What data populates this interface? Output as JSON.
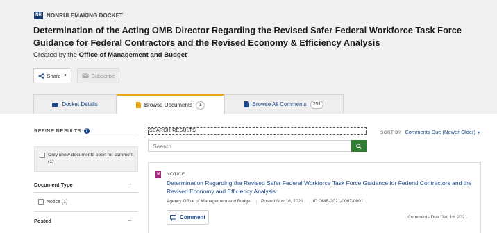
{
  "header": {
    "badge": "NR",
    "docket_type": "NONRULEMAKING DOCKET",
    "title": "Determination of the Acting OMB Director Regarding the Revised Safer Federal Workforce Task Force Guidance for Federal Contractors and the Revised Economy & Efficiency Analysis",
    "created_prefix": "Created by the",
    "created_by": "Office of Management and Budget",
    "share_label": "Share",
    "subscribe_label": "Subscribe"
  },
  "tabs": [
    {
      "label": "Docket Details",
      "icon": "folder-icon"
    },
    {
      "label": "Browse Documents",
      "icon": "document-icon",
      "count": "1"
    },
    {
      "label": "Browse All Comments",
      "icon": "comments-icon",
      "count": "251"
    }
  ],
  "sidebar": {
    "refine_label": "REFINE RESULTS",
    "open_filter_label": "Only show documents open for comment (1)",
    "facets": [
      {
        "title": "Document Type",
        "options": [
          {
            "label": "Notice (1)"
          }
        ]
      },
      {
        "title": "Posted"
      }
    ]
  },
  "search": {
    "results_label": "SEARCH RESULTS",
    "placeholder": "Search",
    "sort_label": "SORT BY",
    "sort_value": "Comments Due (Newer-Older)"
  },
  "results": [
    {
      "type": "NOTICE",
      "title": "Determination Regarding the Revised Safer Federal Workforce Task Force Guidance for Federal Contractors and the Revised Economy and Efficiency Analysis",
      "agency": "Agency Office of Management and Budget",
      "posted": "Posted Nov 16, 2021",
      "id": "ID OMB-2021-0007-0001",
      "comment_label": "Comment",
      "due": "Comments Due Dec 16, 2021"
    }
  ],
  "colors": {
    "header_bg": "#f1f1f1",
    "link": "#1c4a8c",
    "active_tab_accent": "#e8a317",
    "search_button": "#2e7d32",
    "notice_icon": "#a3287f",
    "badge": "#1b3a6b"
  }
}
